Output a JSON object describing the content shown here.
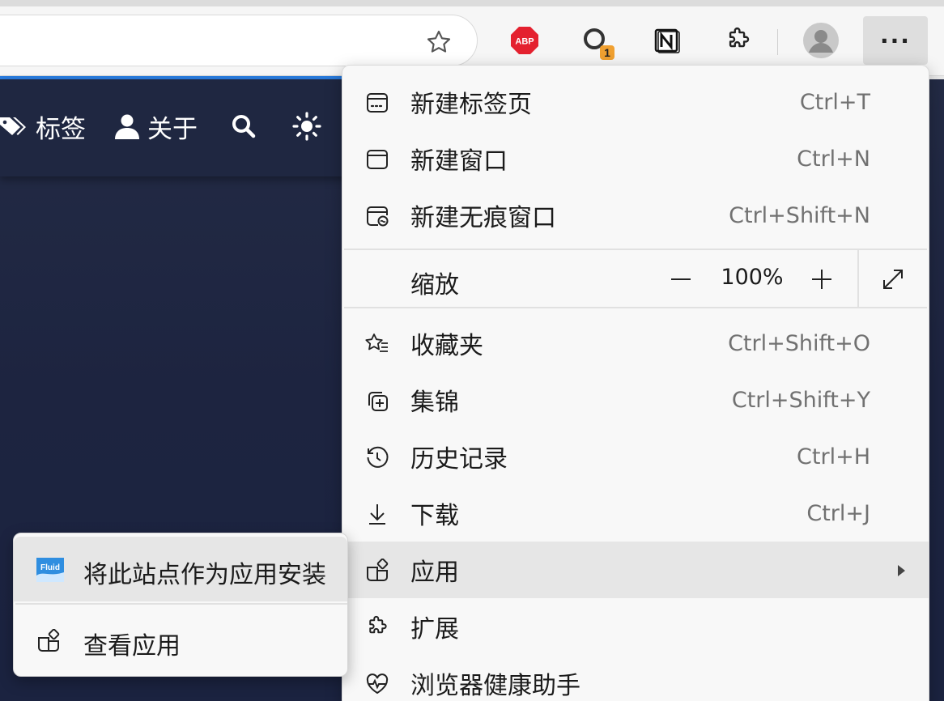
{
  "toolbar": {
    "icons": [
      "star-icon",
      "adblock-plus-icon",
      "tampermonkey-icon",
      "notion-icon",
      "extensions-icon",
      "avatar-icon",
      "more-icon"
    ],
    "abp_label": "ABP",
    "tampermonkey_badge": "1",
    "more_label": "···"
  },
  "site_nav": {
    "items": [
      {
        "label": "标签",
        "icon": "tag-icon"
      },
      {
        "label": "关于",
        "icon": "user-icon"
      }
    ],
    "search_icon": "search-icon",
    "theme_icon": "sun-icon"
  },
  "menu": {
    "items": [
      {
        "label": "新建标签页",
        "shortcut": "Ctrl+T",
        "icon": "new-tab-icon"
      },
      {
        "label": "新建窗口",
        "shortcut": "Ctrl+N",
        "icon": "new-window-icon"
      },
      {
        "label": "新建无痕窗口",
        "shortcut": "Ctrl+Shift+N",
        "icon": "inprivate-icon"
      },
      {
        "label": "收藏夹",
        "shortcut": "Ctrl+Shift+O",
        "icon": "favorites-icon"
      },
      {
        "label": "集锦",
        "shortcut": "Ctrl+Shift+Y",
        "icon": "collections-icon"
      },
      {
        "label": "历史记录",
        "shortcut": "Ctrl+H",
        "icon": "history-icon"
      },
      {
        "label": "下载",
        "shortcut": "Ctrl+J",
        "icon": "download-icon"
      },
      {
        "label": "应用",
        "shortcut": "",
        "icon": "apps-icon"
      },
      {
        "label": "扩展",
        "shortcut": "",
        "icon": "extensions-icon"
      },
      {
        "label": "浏览器健康助手",
        "shortcut": "",
        "icon": "browser-health-icon"
      }
    ],
    "zoom": {
      "label": "缩放",
      "value": "100%",
      "minus": "—",
      "plus": "+"
    }
  },
  "submenu": {
    "items": [
      {
        "label": "将此站点作为应用安装",
        "icon": "fluid-app-icon",
        "icon_text": "Fluid"
      },
      {
        "label": "查看应用",
        "icon": "apps-icon"
      }
    ]
  },
  "colors": {
    "accent": "#2a7de1",
    "page_bg": "#1f2741",
    "menu_bg": "#f8f8f8",
    "abp_red": "#e4212f",
    "badge_orange": "#f0a030"
  }
}
